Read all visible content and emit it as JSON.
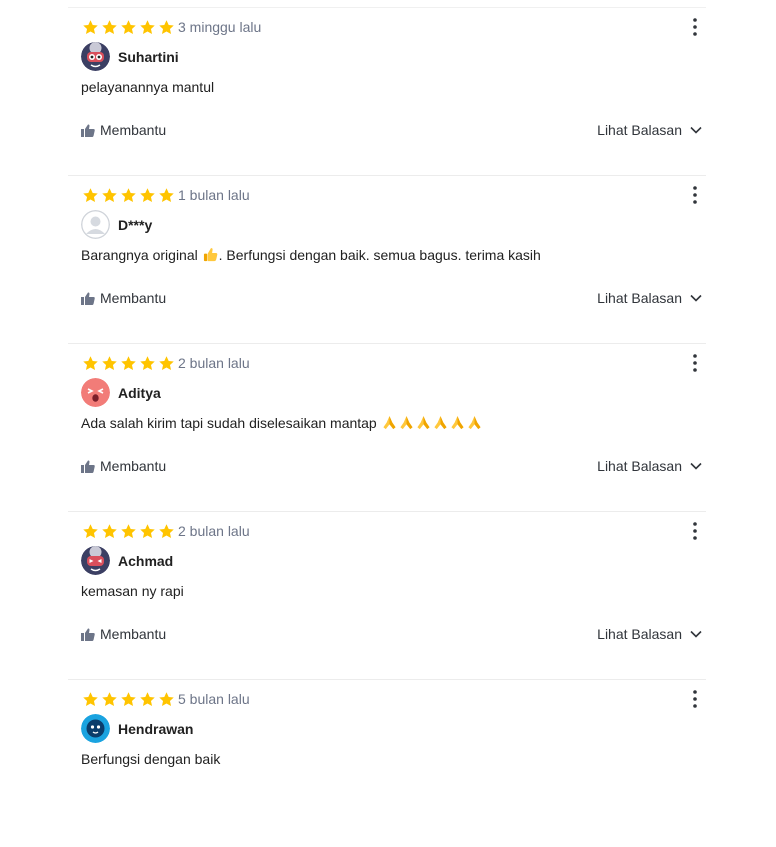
{
  "colors": {
    "star": "#FFC400",
    "muted": "#6D7588",
    "divider": "#ECECEC"
  },
  "reviews": [
    {
      "rating": 5,
      "date": "3 minggu lalu",
      "name": "Suhartini",
      "avatar": "avatar-robot-icon",
      "text": "pelayanannya mantul",
      "emoji": "",
      "emoji_count": 0,
      "helpful": "Membantu",
      "replies": "Lihat Balasan"
    },
    {
      "rating": 5,
      "date": "1 bulan lalu",
      "name": "D***y",
      "avatar": "avatar-default-icon",
      "text": "Barangnya original",
      "emoji": "thumbs-up-icon",
      "emoji_count": 1,
      "text_after": ". Berfungsi dengan baik. semua bagus. terima kasih",
      "helpful": "Membantu",
      "replies": "Lihat Balasan"
    },
    {
      "rating": 5,
      "date": "2 bulan lalu",
      "name": "Aditya",
      "avatar": "avatar-pink-face-icon",
      "text": "Ada salah kirim tapi sudah diselesaikan mantap",
      "emoji": "folded-hands-icon",
      "emoji_count": 6,
      "helpful": "Membantu",
      "replies": "Lihat Balasan"
    },
    {
      "rating": 5,
      "date": "2 bulan lalu",
      "name": "Achmad",
      "avatar": "avatar-robot-icon",
      "text": "kemasan ny rapi",
      "emoji": "",
      "emoji_count": 0,
      "helpful": "Membantu",
      "replies": "Lihat Balasan"
    },
    {
      "rating": 5,
      "date": "5 bulan lalu",
      "name": "Hendrawan",
      "avatar": "avatar-blue-ghost-icon",
      "text": "Berfungsi dengan baik",
      "emoji": "",
      "emoji_count": 0,
      "helpful": "Membantu",
      "replies": "Lihat Balasan"
    }
  ]
}
